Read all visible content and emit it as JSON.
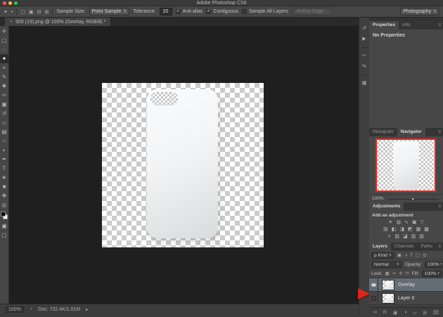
{
  "window": {
    "title": "Adobe Photoshop CS6"
  },
  "options_bar": {
    "tool_icon_glyph": "✦",
    "caret": "▾",
    "selection_modes": [
      "▢",
      "▣",
      "⊟",
      "⊞"
    ],
    "sample_size_label": "Sample Size:",
    "sample_size_value": "Point Sample",
    "tolerance_label": "Tolerance:",
    "tolerance_value": "20",
    "anti_alias_label": "Anti-alias",
    "anti_alias_checked": "✓",
    "contiguous_label": "Contiguous",
    "contiguous_checked": "✓",
    "sample_all_layers_label": "Sample All Layers",
    "sample_all_layers_checked": "",
    "refine_edge_label": "Refine Edge...",
    "workspace_value": "Photography",
    "dropdown_caret": "⇅"
  },
  "document_tab": {
    "close": "×",
    "title": "500 (19).png @ 100% (Overlay, RGB/8) *"
  },
  "tools": [
    {
      "name": "move-tool",
      "glyph": "✛"
    },
    {
      "name": "marquee-tool",
      "glyph": "▢"
    },
    {
      "name": "lasso-tool",
      "glyph": "◌"
    },
    {
      "name": "magic-wand-tool",
      "glyph": "✦",
      "active": true
    },
    {
      "name": "crop-tool",
      "glyph": "⌗"
    },
    {
      "name": "eyedropper-tool",
      "glyph": "✎"
    },
    {
      "name": "healing-brush-tool",
      "glyph": "✚"
    },
    {
      "name": "brush-tool",
      "glyph": "✑"
    },
    {
      "name": "clone-stamp-tool",
      "glyph": "▣"
    },
    {
      "name": "history-brush-tool",
      "glyph": "↺"
    },
    {
      "name": "eraser-tool",
      "glyph": "▱"
    },
    {
      "name": "gradient-tool",
      "glyph": "▤"
    },
    {
      "name": "blur-tool",
      "glyph": "○"
    },
    {
      "name": "dodge-tool",
      "glyph": "◐"
    },
    {
      "name": "pen-tool",
      "glyph": "✒"
    },
    {
      "name": "type-tool",
      "glyph": "T"
    },
    {
      "name": "path-selection-tool",
      "glyph": "➤"
    },
    {
      "name": "shape-tool",
      "glyph": "■"
    },
    {
      "name": "hand-tool",
      "glyph": "✥"
    },
    {
      "name": "zoom-tool",
      "glyph": "◎"
    }
  ],
  "toolbar_extras": {
    "quick_mask_glyph": "▣",
    "screen_mode_glyph": "▢"
  },
  "dock_icons": [
    {
      "name": "history-panel-icon",
      "glyph": "↺"
    },
    {
      "name": "actions-panel-icon",
      "glyph": "▶"
    },
    {
      "name": "brush-panel-icon",
      "glyph": "✑"
    },
    {
      "name": "clone-source-panel-icon",
      "glyph": "⇆"
    },
    {
      "name": "tool-presets-panel-icon",
      "glyph": "▦"
    }
  ],
  "properties_panel": {
    "tab_properties": "Properties",
    "tab_info": "Info",
    "menu_icon": "≡",
    "empty_text": "No Properties"
  },
  "navigator_panel": {
    "tab_histogram": "Histogram",
    "tab_navigator": "Navigator",
    "menu_icon": "≡",
    "zoom_value": "100%",
    "slider_handle": "▲"
  },
  "adjustments_panel": {
    "title": "Adjustments",
    "menu_icon": "≡",
    "subtitle": "Add an adjustment",
    "row1": [
      {
        "name": "brightness-contrast-icon",
        "glyph": "☀"
      },
      {
        "name": "levels-icon",
        "glyph": "▥"
      },
      {
        "name": "curves-icon",
        "glyph": "∿"
      },
      {
        "name": "exposure-icon",
        "glyph": "▣"
      },
      {
        "name": "vibrance-icon",
        "glyph": "▽"
      }
    ],
    "row2": [
      {
        "name": "hue-saturation-icon",
        "glyph": "▤"
      },
      {
        "name": "color-balance-icon",
        "glyph": "◧"
      },
      {
        "name": "black-white-icon",
        "glyph": "◨"
      },
      {
        "name": "photo-filter-icon",
        "glyph": "◩"
      },
      {
        "name": "channel-mixer-icon",
        "glyph": "▦"
      },
      {
        "name": "color-lookup-icon",
        "glyph": "▩"
      }
    ],
    "row3": [
      {
        "name": "invert-icon",
        "glyph": "◐"
      },
      {
        "name": "posterize-icon",
        "glyph": "▨"
      },
      {
        "name": "threshold-icon",
        "glyph": "◪"
      },
      {
        "name": "gradient-map-icon",
        "glyph": "▥"
      },
      {
        "name": "selective-color-icon",
        "glyph": "▧"
      }
    ]
  },
  "layers_panel": {
    "tab_layers": "Layers",
    "tab_channels": "Channels",
    "tab_paths": "Paths",
    "menu_icon": "≡",
    "filter_prefix": "ρ",
    "filter_label": "Kind",
    "filter_icons": [
      {
        "name": "filter-pixel-layers-icon",
        "glyph": "▣"
      },
      {
        "name": "filter-adjustment-layers-icon",
        "glyph": "◑"
      },
      {
        "name": "filter-type-layers-icon",
        "glyph": "T"
      },
      {
        "name": "filter-shape-layers-icon",
        "glyph": "▢"
      },
      {
        "name": "filter-smart-objects-icon",
        "glyph": "⊡"
      }
    ],
    "blend_mode_value": "Normal",
    "opacity_label": "Opacity:",
    "opacity_value": "100%",
    "lock_label": "Lock:",
    "lock_icons": [
      {
        "name": "lock-transparency-icon",
        "glyph": "▦"
      },
      {
        "name": "lock-pixels-icon",
        "glyph": "✑"
      },
      {
        "name": "lock-position-icon",
        "glyph": "✛"
      },
      {
        "name": "lock-all-icon",
        "glyph": "⊓"
      }
    ],
    "fill_label": "Fill:",
    "fill_value": "100%",
    "layers": [
      {
        "name": "Overlay",
        "visible": true,
        "selected": true
      },
      {
        "name": "Layer 0",
        "visible": false,
        "selected": false
      }
    ],
    "bottom_icons": [
      {
        "name": "link-layers-icon",
        "glyph": "∞"
      },
      {
        "name": "layer-effects-icon",
        "glyph": "fx"
      },
      {
        "name": "add-layer-mask-icon",
        "glyph": "▣"
      },
      {
        "name": "new-adjustment-layer-icon",
        "glyph": "◑"
      },
      {
        "name": "new-group-icon",
        "glyph": "▱"
      },
      {
        "name": "new-layer-icon",
        "glyph": "⊞"
      },
      {
        "name": "delete-layer-icon",
        "glyph": "⌧"
      }
    ]
  },
  "status_bar": {
    "zoom_value": "100%",
    "status_icon_glyph": "◔",
    "doc_info": "Doc: 732.4K/1.01M",
    "arrow_glyph": "▸"
  },
  "colors": {
    "annotation_arrow": "#e02417",
    "navigator_view_border": "#ff2018",
    "selected_layer_row": "#646c74",
    "traffic_red": "#fc5753",
    "traffic_yellow": "#fdbc40",
    "traffic_green": "#33c748"
  }
}
